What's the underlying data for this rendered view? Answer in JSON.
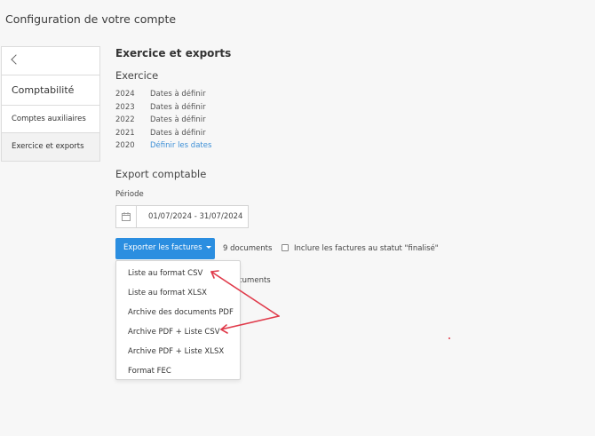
{
  "page": {
    "title": "Configuration de votre compte"
  },
  "sidebar": {
    "section": "Comptabilité",
    "items": [
      {
        "label": "Comptes auxiliaires"
      },
      {
        "label": "Exercice et exports"
      }
    ]
  },
  "main": {
    "title": "Exercice et exports",
    "exercice": {
      "heading": "Exercice",
      "years": [
        {
          "year": "2024",
          "status": "Dates à définir"
        },
        {
          "year": "2023",
          "status": "Dates à définir"
        },
        {
          "year": "2022",
          "status": "Dates à définir"
        },
        {
          "year": "2021",
          "status": "Dates à définir"
        },
        {
          "year": "2020",
          "status": "Définir les dates"
        }
      ]
    },
    "export": {
      "heading": "Export comptable",
      "period_label": "Période",
      "period_value": "01/07/2024 - 31/07/2024",
      "button_label": "Exporter les factures",
      "doc_count": "9 documents",
      "checkbox_label": "Inclure les factures au statut \"finalisé\"",
      "behind_text": "cuments"
    },
    "dropdown": {
      "items": [
        "Liste au format CSV",
        "Liste au format XLSX",
        "Archive des documents PDF",
        "Archive PDF + Liste CSV",
        "Archive PDF + Liste XLSX",
        "Format FEC"
      ]
    }
  },
  "colors": {
    "accent": "#2b8ee0",
    "link": "#3d8fd6",
    "annotation": "#e03a4a"
  },
  "icons": {
    "back": "chevron-left-icon",
    "calendar": "calendar-icon",
    "caret": "caret-down-icon"
  }
}
